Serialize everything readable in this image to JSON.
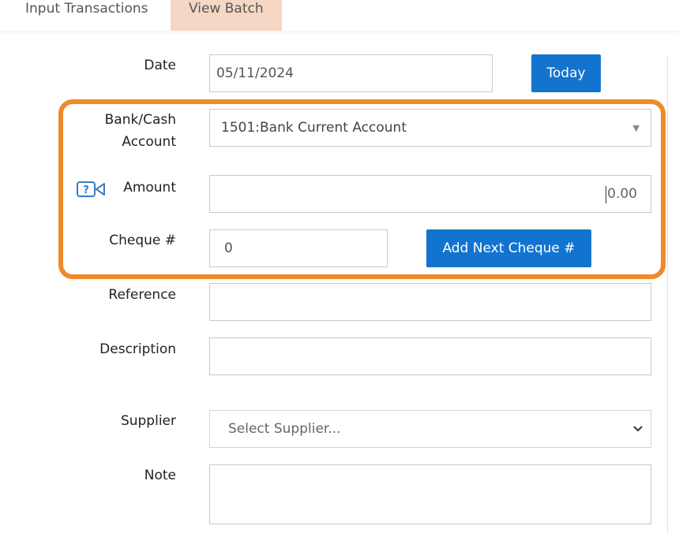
{
  "tabs": [
    {
      "label": "Input Transactions"
    },
    {
      "label": "View Batch"
    }
  ],
  "form": {
    "date": {
      "label": "Date",
      "value": "05/11/2024",
      "today_button": "Today"
    },
    "bank_cash_account": {
      "label_line1": "Bank/Cash",
      "label_line2": "Account",
      "value": "1501:Bank Current Account"
    },
    "amount": {
      "label": "Amount",
      "placeholder": "0.00",
      "help_icon": "video-help-icon"
    },
    "cheque": {
      "label": "Cheque #",
      "value": "0",
      "add_next_button": "Add Next Cheque #"
    },
    "reference": {
      "label": "Reference",
      "value": ""
    },
    "description": {
      "label": "Description",
      "value": ""
    },
    "supplier": {
      "label": "Supplier",
      "selected": "Select Supplier..."
    },
    "note": {
      "label": "Note",
      "value": ""
    }
  },
  "colors": {
    "primary_button": "#1274cf",
    "highlight": "#ef8a2a",
    "active_tab": "#f5d7c3"
  }
}
